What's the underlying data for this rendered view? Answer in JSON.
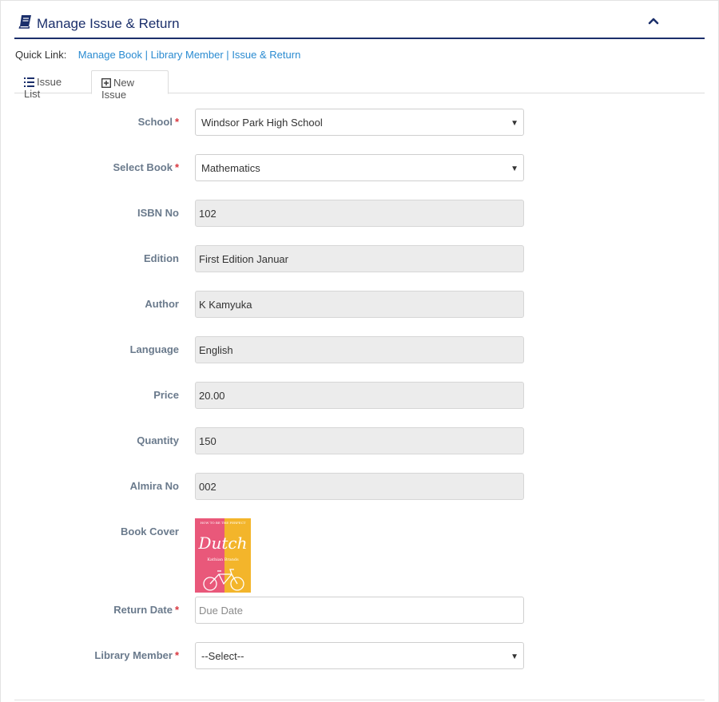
{
  "panel": {
    "title": "Manage Issue & Return",
    "icon": "book-icon",
    "collapse_icon": "chevron-up-icon",
    "accent": "#1b2f6b"
  },
  "quick_link": {
    "label": "Quick Link:",
    "links": [
      "Manage Book",
      "Library Member",
      "Issue & Return"
    ],
    "separator": "|"
  },
  "tabs": [
    {
      "label": "Issue List",
      "icon": "list-icon",
      "active": false
    },
    {
      "label": "New Issue",
      "icon": "plus-square-icon",
      "active": true
    }
  ],
  "form": {
    "school": {
      "label": "School",
      "required": "*",
      "value": "Windsor Park High School"
    },
    "select_book": {
      "label": "Select Book",
      "required": "*",
      "value": "Mathematics"
    },
    "isbn": {
      "label": "ISBN No",
      "value": "102"
    },
    "edition": {
      "label": "Edition",
      "value": "First Edition Januar"
    },
    "author": {
      "label": "Author",
      "value": "K Kamyuka"
    },
    "language": {
      "label": "Language",
      "value": "English"
    },
    "price": {
      "label": "Price",
      "value": "20.00"
    },
    "quantity": {
      "label": "Quantity",
      "value": "150"
    },
    "almira": {
      "label": "Almira No",
      "value": "002"
    },
    "book_cover": {
      "label": "Book Cover",
      "cover_top_text": "HOW TO BE THE PERFECT",
      "cover_title": "Dutch",
      "cover_author": "Kathian Brands"
    },
    "return_date": {
      "label": "Return Date",
      "required": "*",
      "placeholder": "Due Date"
    },
    "library_member": {
      "label": "Library Member",
      "required": "*",
      "value": "--Select--"
    }
  },
  "colors": {
    "link": "#2a8bd1",
    "required": "#d9363e",
    "label": "#6a7a8c",
    "readonly_bg": "#ececec"
  }
}
